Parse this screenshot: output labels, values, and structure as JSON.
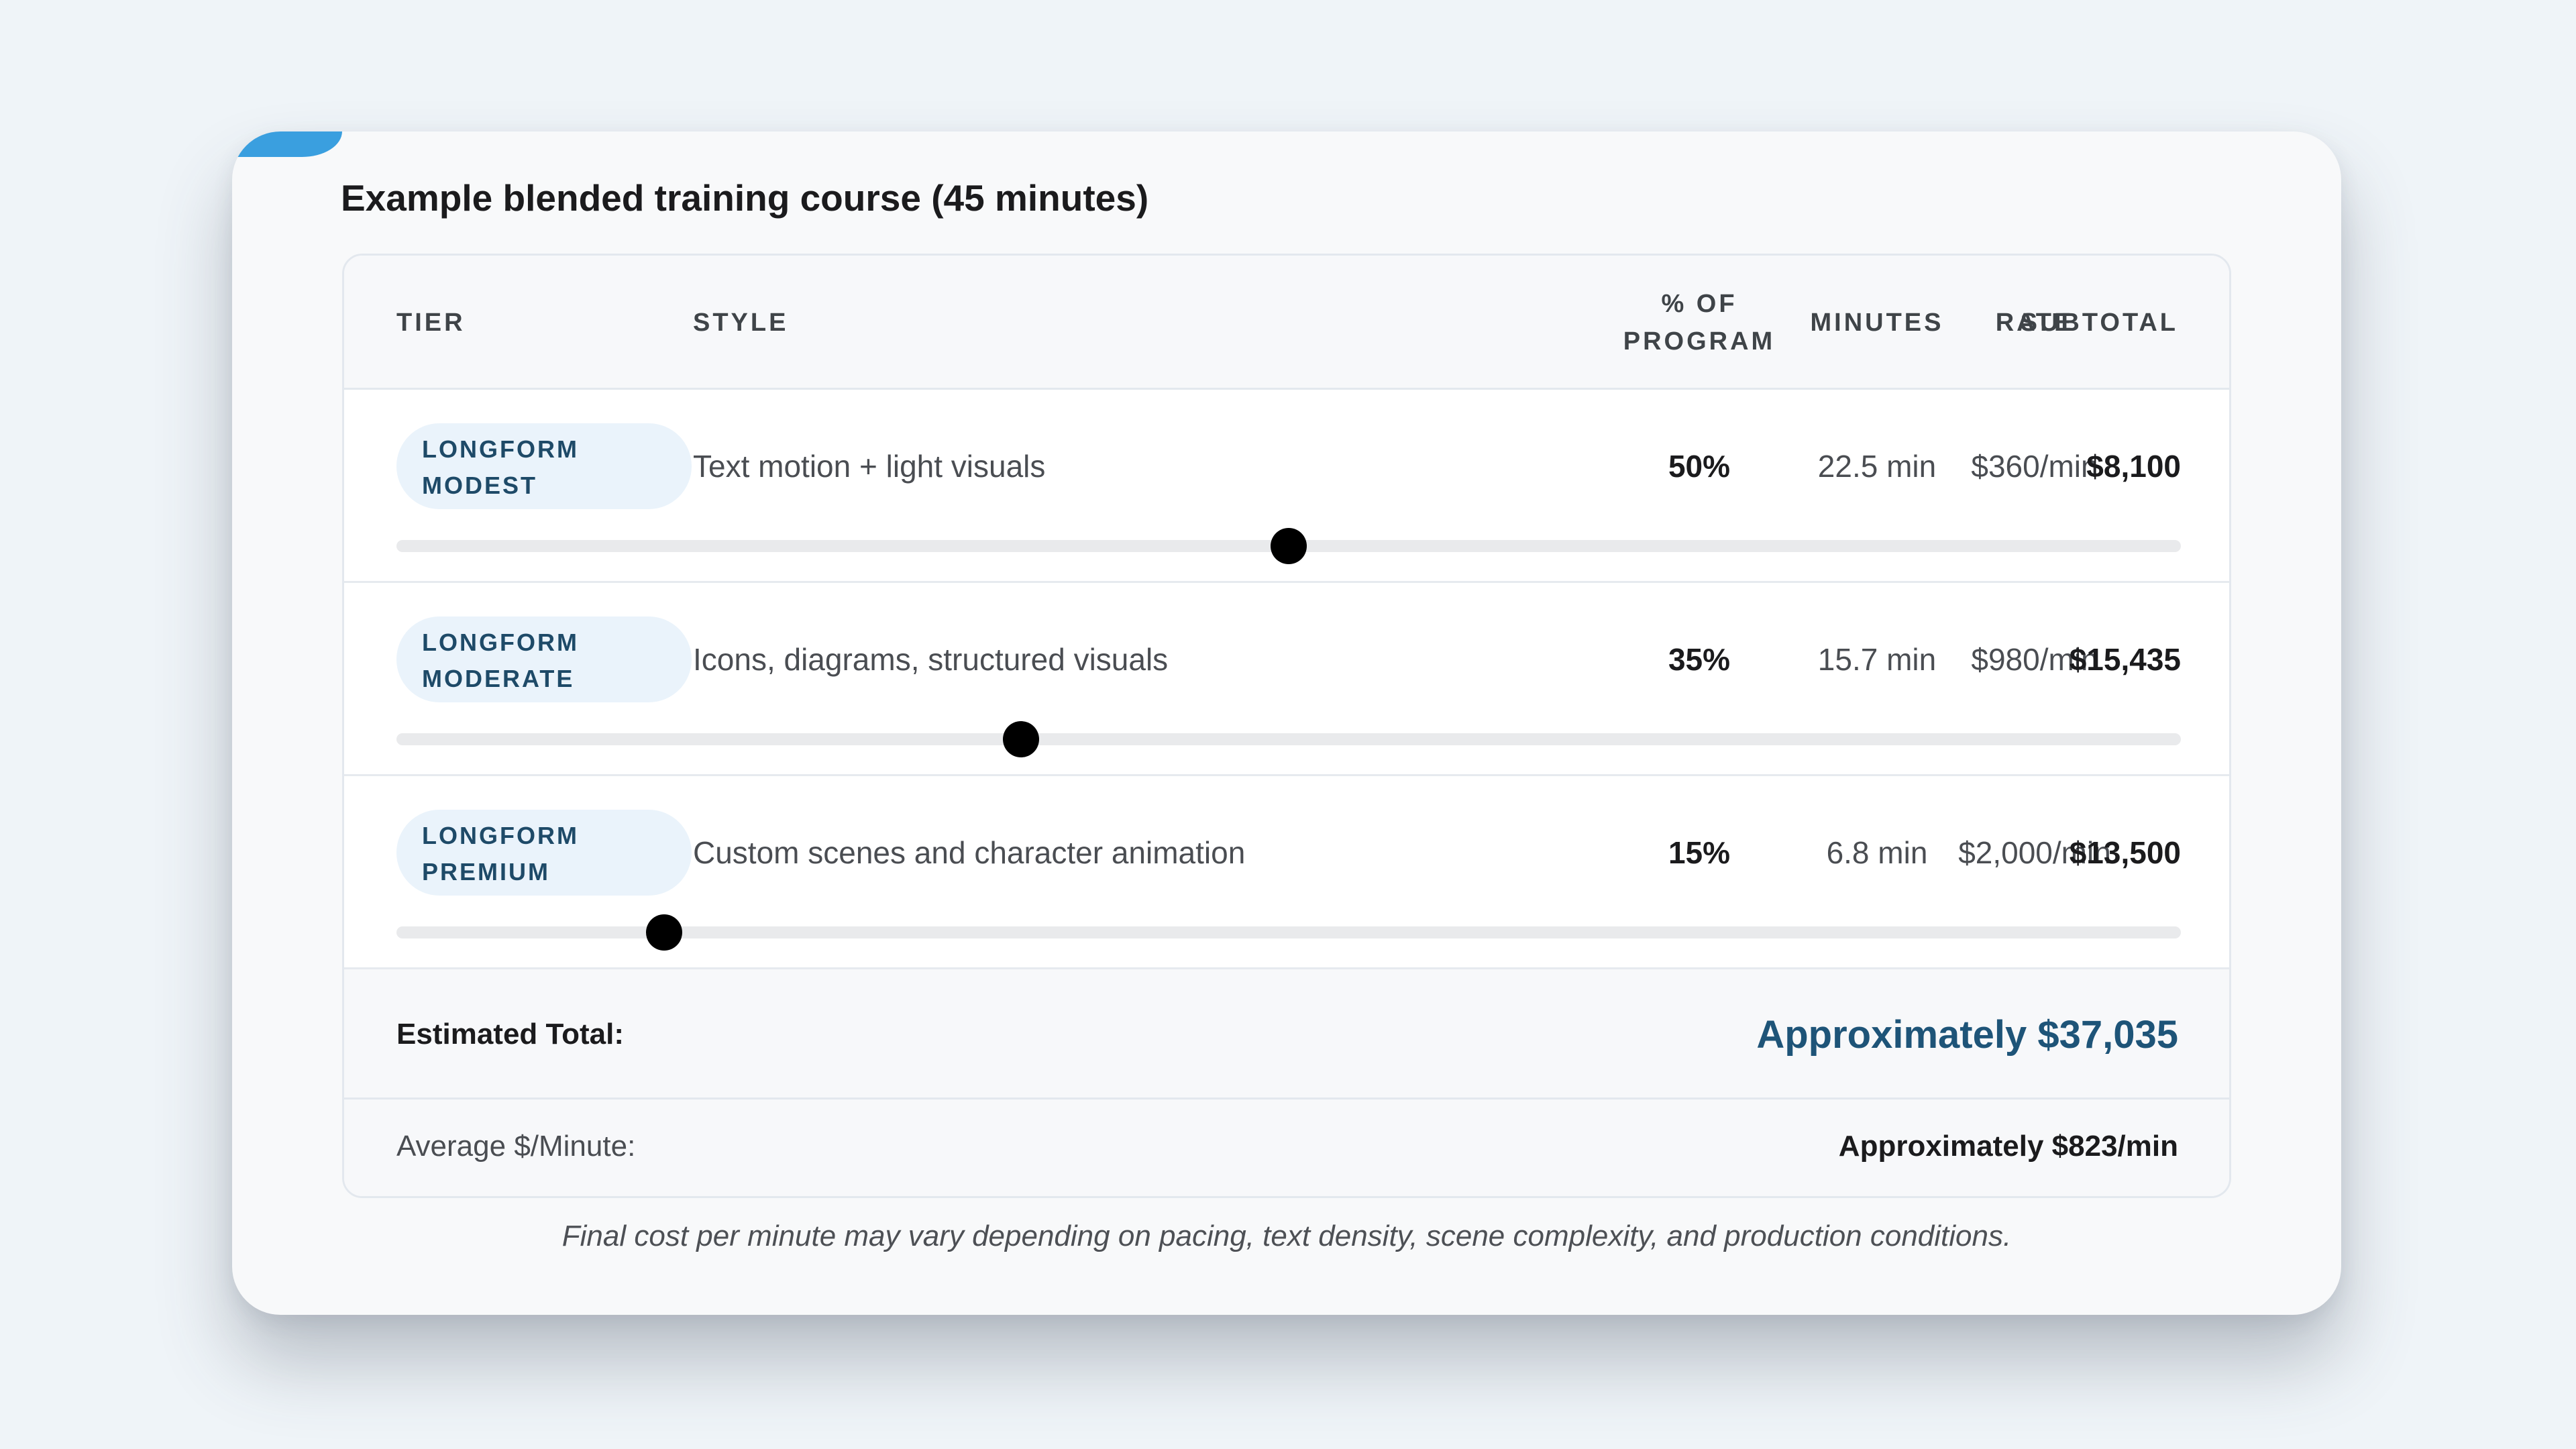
{
  "card": {
    "title": "Example blended training course (45 minutes)",
    "accent_color": "#3a9fdf"
  },
  "table": {
    "headers": {
      "tier": "TIER",
      "style": "STYLE",
      "pct_line1": "% OF",
      "pct_line2": "PROGRAM",
      "minutes": "MINUTES",
      "rate": "RATE",
      "subtotal": "SUBTOTAL"
    },
    "rows": [
      {
        "tier_line1": "LONGFORM",
        "tier_line2": "MODEST",
        "style": "Text motion + light visuals",
        "pct": "50%",
        "minutes": "22.5 min",
        "rate": "$360/min",
        "subtotal": "$8,100",
        "slider_value": 0.5
      },
      {
        "tier_line1": "LONGFORM",
        "tier_line2": "MODERATE",
        "style": "Icons, diagrams, structured visuals",
        "pct": "35%",
        "minutes": "15.7 min",
        "rate": "$980/min",
        "subtotal": "$15,435",
        "slider_value": 0.35
      },
      {
        "tier_line1": "LONGFORM",
        "tier_line2": "PREMIUM",
        "style": "Custom scenes and character animation",
        "pct": "15%",
        "minutes": "6.8 min",
        "rate": "$2,000/min",
        "subtotal": "$13,500",
        "slider_value": 0.15
      }
    ]
  },
  "summary": {
    "total_label": "Estimated Total:",
    "total_value": "Approximately $37,035",
    "total_color": "#1e5478",
    "avg_label": "Average $/Minute:",
    "avg_value": "Approximately $823/min"
  },
  "footnote": "Final cost per minute may vary depending on pacing, text density, scene complexity, and production conditions."
}
